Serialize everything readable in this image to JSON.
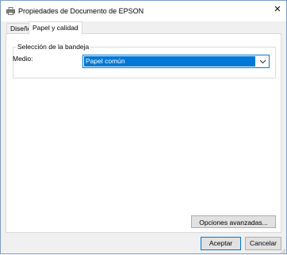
{
  "window": {
    "title": "Propiedades de Documento de EPSON",
    "close_glyph": "✕",
    "icon": "printer-icon"
  },
  "tabs": [
    {
      "label": "Diseño",
      "active": false
    },
    {
      "label": "Papel y calidad",
      "active": true
    }
  ],
  "tray_group": {
    "legend": "Selección de la bandeja",
    "media_label": "Medio:",
    "media_value": "Papel común"
  },
  "buttons": {
    "advanced": "Opciones avanzadas...",
    "ok": "Aceptar",
    "cancel": "Cancelar"
  },
  "colors": {
    "accent": "#0078d7",
    "window_bg": "#f0f0f0",
    "panel_bg": "#ffffff"
  }
}
